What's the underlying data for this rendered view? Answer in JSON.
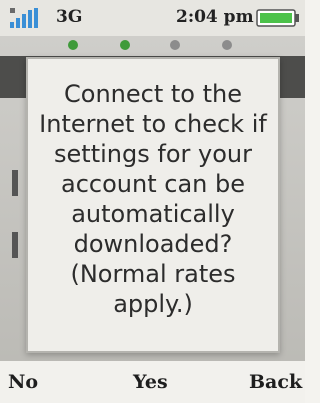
{
  "status_bar": {
    "network": "3G",
    "time": "2:04 pm",
    "signal_icon": "signal-bars-icon",
    "battery_icon": "battery-icon",
    "signal_color": "#3a8fd6",
    "battery_color": "#4cc24a"
  },
  "pager": {
    "active_color": "#3f9a3a",
    "inactive_color": "#8c8c8c"
  },
  "dialog": {
    "message": "Connect to the\nInternet to check if\nsettings for your\naccount can be\nautomatically\ndownloaded?\n(Normal rates\napply.)"
  },
  "softkeys": {
    "left": "No",
    "center": "Yes",
    "right": "Back"
  }
}
